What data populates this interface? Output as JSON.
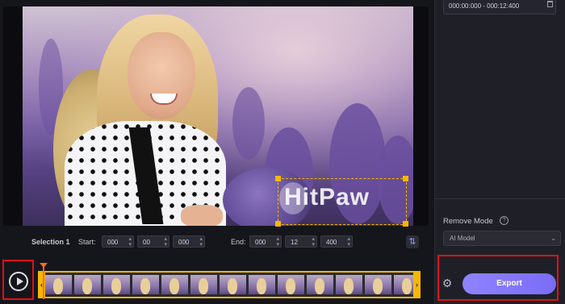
{
  "preview": {
    "watermark_text": "HitPaw"
  },
  "selection": {
    "label": "Selection 1",
    "start_label": "Start:",
    "start": [
      "000",
      "00",
      "000"
    ],
    "end_label": "End:",
    "end": [
      "000",
      "12",
      "400"
    ]
  },
  "right_panel": {
    "time_range": "000:00:000 - 000:12:400",
    "remove_mode_label": "Remove Mode",
    "model_value": "AI Model",
    "export_label": "Export"
  },
  "colors": {
    "accent": "#7a6cf7",
    "selection": "#f5b800",
    "highlight": "#e0101a"
  },
  "icons": [
    "play-icon",
    "gear-icon",
    "help-icon",
    "trash-icon",
    "swap-icon",
    "chevron-down-icon"
  ]
}
